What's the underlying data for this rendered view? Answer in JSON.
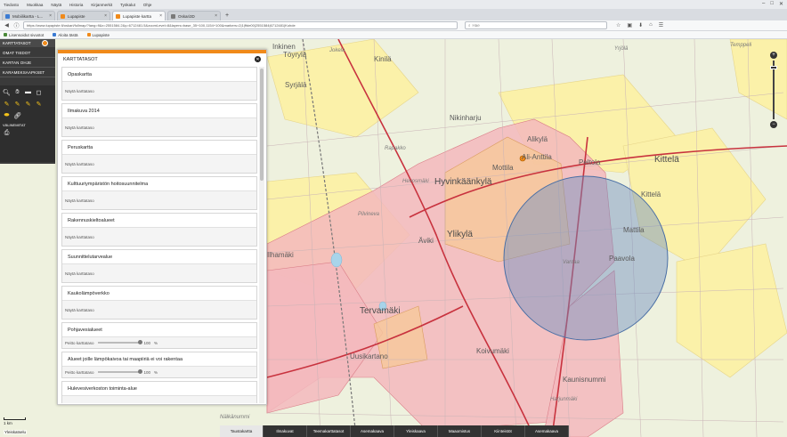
{
  "browser": {
    "menu": [
      "Tiedosto",
      "Muokkaa",
      "Näytä",
      "Historia",
      "Kirjanmerkit",
      "Työkalut",
      "Ohje"
    ],
    "tabs": [
      {
        "label": "Mobiilikartta - L...",
        "color": "#3b7bd3",
        "active": false
      },
      {
        "label": "Lupapiste",
        "color": "#f08a1a",
        "active": false
      },
      {
        "label": "Lupapiste kartta",
        "color": "#f08a1a",
        "active": true
      },
      {
        "label": "Oskari3D",
        "color": "#7a7a7a",
        "active": false
      }
    ],
    "new_tab": "+",
    "window_controls": [
      "–",
      "□",
      "✕"
    ],
    "url": "https://www.lupapiste.fi/oskari/fullmap/?lang=fi&x=2551584.2&y=6712481.5&zoomLevel=8&layers=base_35+100,1154+100&markers=2|1|ffde00|2551584|6712481|Kohde",
    "search_placeholder": "Hae",
    "toolbar_icons": [
      "☆",
      "▣",
      "⬇",
      "⌂",
      "☰"
    ]
  },
  "bookmarks": [
    {
      "label": "Lisensoidut sivustot",
      "color": "#4a8a3a"
    },
    {
      "label": "Aloita tästä",
      "color": "#3b7bd3"
    },
    {
      "label": "Lupapiste",
      "color": "#f08a1a"
    }
  ],
  "sidebar": {
    "top_label": "KARTTATASOT",
    "items": [
      "OMAT TIEDOT",
      "KARTAN OHJE",
      "KARAMEKSAAPKSET"
    ],
    "tools_header": "VÄLINEMITAT"
  },
  "layers_panel": {
    "title": "KARTTATASOT",
    "close": "✕",
    "show_label": "Näytä karttataso",
    "opacity_label": "Peitto karttataso",
    "layers": [
      {
        "name": "Opaskartta",
        "slider": false
      },
      {
        "name": "Ilmakuva 2014",
        "slider": false
      },
      {
        "name": "Peruskartta",
        "slider": false
      },
      {
        "name": "Kulttuuriympäristön hoitosuunnitelma",
        "slider": false
      },
      {
        "name": "Rakennuskieltoalueet",
        "slider": false
      },
      {
        "name": "Suunnittelutarvealue",
        "slider": false
      },
      {
        "name": "Kaukolämpöverkko",
        "slider": false
      },
      {
        "name": "Pohjavesialueet",
        "slider": true,
        "opacity": 100,
        "unit": "%"
      },
      {
        "name": "Alueet joille lämpökaivoa tai maapiiriä ei voi rakentaa",
        "slider": true,
        "opacity": 100,
        "unit": "%"
      },
      {
        "name": "Hulevesiverkoston toiminta-alue",
        "slider": false
      }
    ]
  },
  "map": {
    "labels": [
      {
        "text": "Inkinen",
        "cls": "mid"
      },
      {
        "text": "Töyrylä",
        "cls": "mid"
      },
      {
        "text": "Syrjälä",
        "cls": "mid"
      },
      {
        "text": "Jokela",
        "cls": "sm"
      },
      {
        "text": "Kinilä",
        "cls": "mid"
      },
      {
        "text": "Nikinharju",
        "cls": "mid"
      },
      {
        "text": "Alikylä",
        "cls": "mid"
      },
      {
        "text": "Ali-Anttila",
        "cls": "mid"
      },
      {
        "text": "Mottila",
        "cls": "mid"
      },
      {
        "text": "Peltola",
        "cls": "mid"
      },
      {
        "text": "Kittelä",
        "cls": "big"
      },
      {
        "text": "Hyvinkäänkylä",
        "cls": "big"
      },
      {
        "text": "Hevosmäki",
        "cls": "sm"
      },
      {
        "text": "Rapakko",
        "cls": "sm"
      },
      {
        "text": "Pilvineva",
        "cls": "sm"
      },
      {
        "text": "Ylikylä",
        "cls": "big"
      },
      {
        "text": "Kittelä",
        "cls": "mid"
      },
      {
        "text": "Mattila",
        "cls": "mid"
      },
      {
        "text": "Paavola",
        "cls": "mid"
      },
      {
        "text": "Äviki",
        "cls": "mid"
      },
      {
        "text": "Vantaa",
        "cls": "sm"
      },
      {
        "text": "Tervamäki",
        "cls": "big"
      },
      {
        "text": "Ilhamäki",
        "cls": "mid"
      },
      {
        "text": "Uusikartano",
        "cls": "mid"
      },
      {
        "text": "Koivumäki",
        "cls": "mid"
      },
      {
        "text": "Kaunisnummi",
        "cls": "mid"
      },
      {
        "text": "Harjunmäki",
        "cls": "sm"
      },
      {
        "text": "Nälkänummi",
        "cls": "sm"
      },
      {
        "text": "Temppeli",
        "cls": "sm"
      },
      {
        "text": "Yrjölä",
        "cls": "sm"
      }
    ],
    "scale": "1 km",
    "copyright": "Yleiskatselu"
  },
  "bottom_tabs": [
    {
      "label": "Taustakartta",
      "active": true
    },
    {
      "label": "Ilmakuvat",
      "active": false
    },
    {
      "label": "Teemakarttatasot",
      "active": false
    },
    {
      "label": "Asemakaava",
      "active": false
    },
    {
      "label": "Yleiskaava",
      "active": false
    },
    {
      "label": "Maaomistus",
      "active": false
    },
    {
      "label": "Kiinteistöt",
      "active": false
    },
    {
      "label": "Asemakaava",
      "active": false
    }
  ],
  "zoom": {
    "plus": "+",
    "minus": "−"
  },
  "colors": {
    "accent": "#f08a1a",
    "zone_red": "#f3b8bd",
    "zone_yellow": "#fbf1a9",
    "circle": "#6d8ec0"
  }
}
